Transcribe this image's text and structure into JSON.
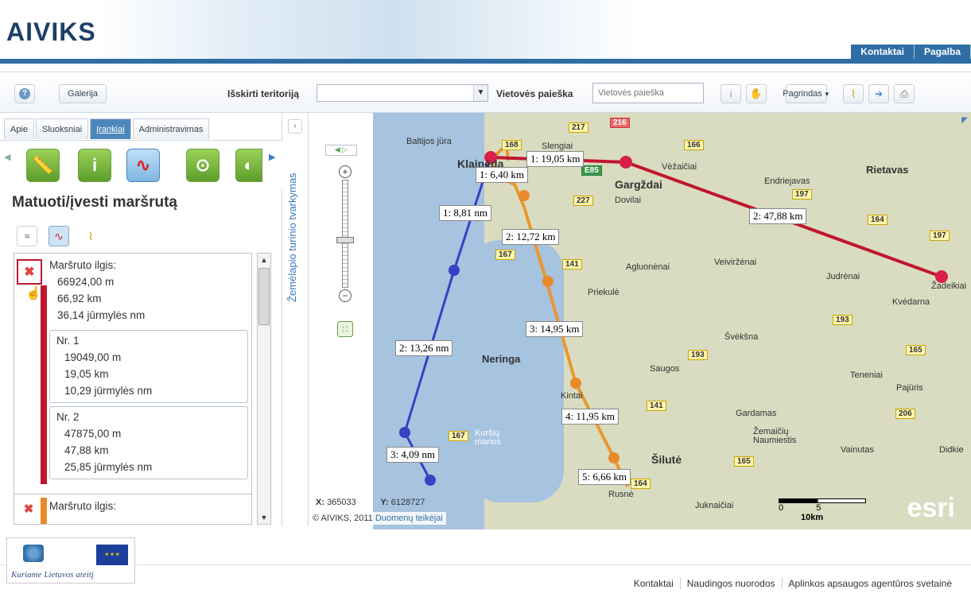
{
  "header": {
    "logo": "AIVIKS",
    "links": [
      "Kontaktai",
      "Pagalba"
    ]
  },
  "toolbar": {
    "help_icon": "help-icon",
    "gallery": "Galerija",
    "territory_label": "Išskirti teritoriją",
    "territory_value": "",
    "search_label": "Vietovės paieška",
    "search_placeholder": "Vietovės paieška",
    "basemap": "Pagrindas"
  },
  "tabs": [
    {
      "label": "Apie"
    },
    {
      "label": "Sluoksniai"
    },
    {
      "label": "Įrankiai",
      "active": true
    },
    {
      "label": "Administravimas"
    }
  ],
  "tool": {
    "title": "Matuoti/įvesti maršrutą"
  },
  "routes": [
    {
      "label": "Maršruto ilgis:",
      "m": "66924,00 m",
      "km": "66,92 km",
      "nm": "36,14 jūrmylės nm",
      "color": "#c0162e",
      "segments": [
        {
          "label": "Nr. 1",
          "m": "19049,00 m",
          "km": "19,05 km",
          "nm": "10,29 jūrmylės nm"
        },
        {
          "label": "Nr. 2",
          "m": "47875,00 m",
          "km": "47,88 km",
          "nm": "25,85 jūrmylės nm"
        }
      ]
    },
    {
      "label": "Maršruto ilgis:",
      "color": "#e88a2a"
    }
  ],
  "sidebar_vertical": "Žemėlapio turinio tvarkymas",
  "map": {
    "labels": {
      "red1": "1: 19,05 km",
      "red2": "2: 47,88 km",
      "orange1": "1: 6,40 km",
      "orange2": "2: 12,72 km",
      "orange3": "3: 14,95 km",
      "orange4": "4: 11,95 km",
      "orange5": "5: 6,66 km",
      "blue1": "1: 8,81 nm",
      "blue2": "2: 13,26 nm",
      "blue3": "3: 4,09 nm"
    },
    "places": {
      "baltijos": "Baltijos jūra",
      "klaipeda": "Klaipėda",
      "slengiai": "Slengiai",
      "vezaiciai": "Vėžaičiai",
      "gargzdai": "Gargždai",
      "dovilai": "Dovilai",
      "rietavas": "Rietavas",
      "endriejavas": "Endriejavas",
      "veivirzenai": "Veiviržėnai",
      "agluonenai": "Agluonėnai",
      "priekule": "Priekulė",
      "judrenai": "Judrėnai",
      "zadeikiai": "Žadeikiai",
      "kvedarna": "Kvėdarna",
      "sveksna": "Švėkšna",
      "neringa": "Neringa",
      "saugos": "Saugos",
      "teneniai": "Teneniai",
      "pajuris": "Pajūris",
      "kintai": "Kintai",
      "gardamas": "Gardamas",
      "kursiu": "Kuršių marios",
      "zemaiciu": "Žemaičių Naumiestis",
      "vainutas": "Vainutas",
      "didkiemis": "Didkie",
      "silute": "Šilutė",
      "rusne": "Rusnė",
      "juknaiciai": "Juknaičiai"
    },
    "roads": [
      "217",
      "216",
      "168",
      "166",
      "197",
      "227",
      "164",
      "167",
      "141",
      "193",
      "165",
      "206",
      "197",
      "164",
      "193",
      "167",
      "141",
      "165",
      "E85"
    ],
    "coords": {
      "x_label": "X:",
      "x": "365033",
      "y_label": "Y:",
      "y": "6128727"
    },
    "credit": "© AIVIKS, 2011",
    "credit_link": "Duomenų teikėjai",
    "scale": [
      "0",
      "5",
      "10km"
    ],
    "esri": "esri"
  },
  "footer": {
    "logo_text": "Kuriame Lietuvos ateitį",
    "links": [
      "Kontaktai",
      "Naudingos nuorodos",
      "Aplinkos apsaugos agentūros svetainė"
    ]
  }
}
